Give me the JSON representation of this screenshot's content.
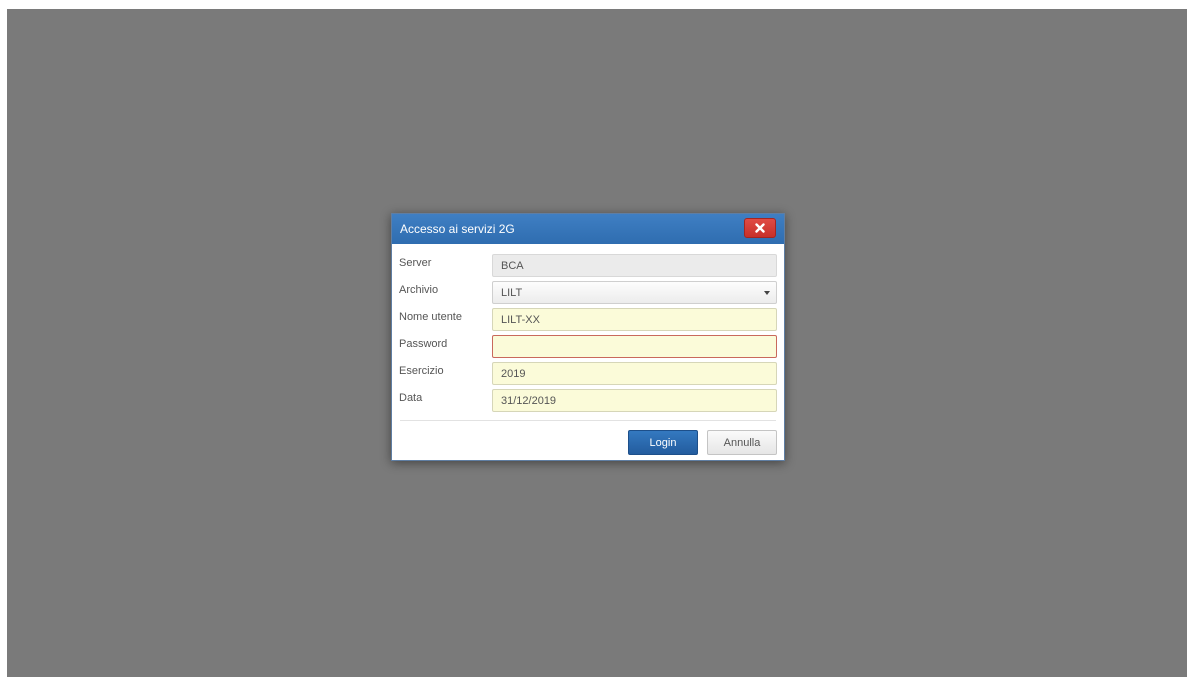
{
  "dialog": {
    "title": "Accesso ai servizi 2G",
    "close_icon": "close-icon"
  },
  "form": {
    "server": {
      "label": "Server",
      "value": "BCA"
    },
    "archivio": {
      "label": "Archivio",
      "value": "LILT"
    },
    "nome_utente": {
      "label": "Nome utente",
      "value": "LILT-XX"
    },
    "password": {
      "label": "Password",
      "value": ""
    },
    "esercizio": {
      "label": "Esercizio",
      "value": "2019"
    },
    "data": {
      "label": "Data",
      "value": "31/12/2019"
    }
  },
  "buttons": {
    "login": "Login",
    "cancel": "Annulla"
  },
  "colors": {
    "backdrop": "#7a7a7a",
    "titlebar": "#3479c0",
    "close": "#d63a34",
    "field_highlight": "#fbfbd9",
    "error_border": "#c9695c"
  }
}
